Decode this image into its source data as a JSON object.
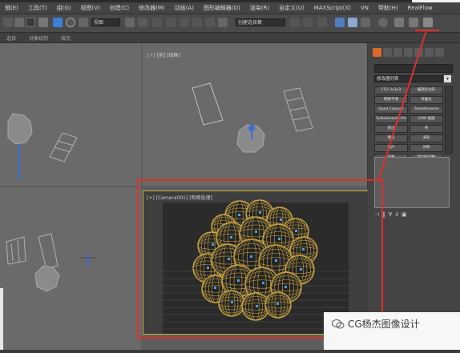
{
  "menu": [
    "辑(E)",
    "工具(T)",
    "组(G)",
    "视图(V)",
    "创建(C)",
    "修改器(M)",
    "动画(A)",
    "图形编辑器(D)",
    "渲染(R)",
    "自定义(U)",
    "MAXScript(X)",
    "VN",
    "帮助(H)",
    "RealFlow"
  ],
  "toolbar": {
    "view_dropdown": "视图",
    "selection_set_dropdown": "创建选择集"
  },
  "ribbon": [
    "选择",
    "对象绘制",
    "填充"
  ],
  "viewports": {
    "top_right_label": "[+] [前] [线框]",
    "camera_label": "[+] [Camera001] [明暗处理]"
  },
  "command_panel": {
    "modifier_list": "修改器列表",
    "buttons": [
      "FFD 3x3x3",
      "编辑多边形",
      "网格平滑",
      "弯曲化",
      "Quad Capsule",
      "TurboReverse",
      "TurboSmooth Pro",
      "UVW 贴图",
      "挤出",
      "壳",
      "倒角",
      "涡轮",
      "面片",
      "对称",
      "晶格",
      "四边形切换"
    ]
  },
  "watermark": {
    "text": "CG杨杰图像设计"
  },
  "colors": {
    "annotation_red": "#e0302a",
    "sphere_gold": "#c9a440",
    "node_blue": "#4aa3e0",
    "active_tab_orange": "#e06a2a"
  }
}
